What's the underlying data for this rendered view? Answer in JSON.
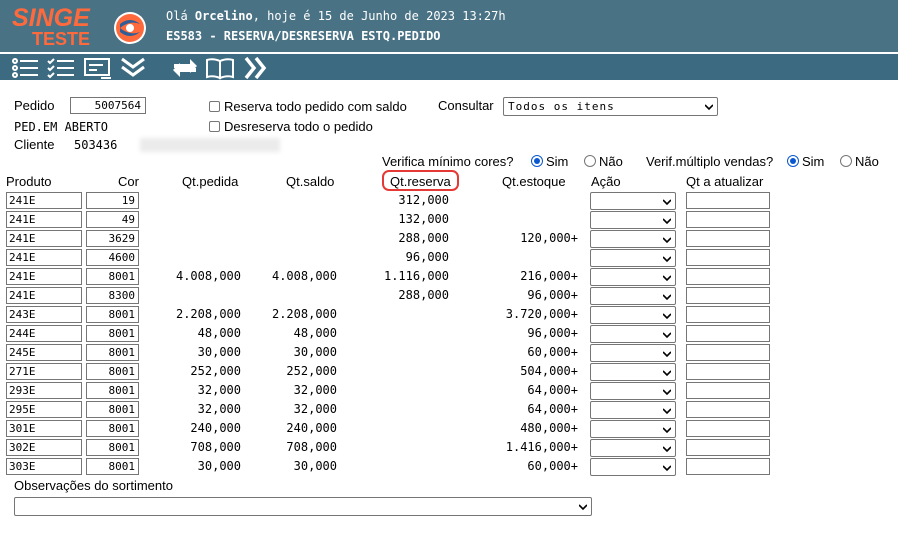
{
  "header": {
    "logo_top": "SINGE",
    "logo_bottom": "TESTE",
    "greeting_prefix": "Olá ",
    "user": "Orcelino",
    "greeting_suffix": ", hoje é 15 de Junho de 2023 13:27h",
    "screen_title": "ES583 - RESERVA/DESRESERVA ESTQ.PEDIDO"
  },
  "colors": {
    "header_bg": "#4a7285",
    "toolbar_bg": "#3c6a80",
    "logo": "#ff6a3d",
    "highlight": "#e53935"
  },
  "toolbar": {
    "icons": [
      "list-icon",
      "checklist-icon",
      "card-icon",
      "double-chevron-down-icon",
      "refresh-icon",
      "book-icon",
      "double-chevron-right-icon"
    ]
  },
  "form": {
    "pedido_label": "Pedido",
    "pedido_value": "5007564",
    "status": "PED.EM ABERTO",
    "cliente_label": "Cliente",
    "cliente_code": "503436",
    "reserva_todo": "Reserva todo pedido com saldo",
    "desreserva_todo": "Desreserva todo o pedido",
    "consultar_label": "Consultar",
    "consultar_value": "Todos os itens",
    "verifica_cores_label": "Verifica mínimo cores?",
    "verif_multiplo_label": "Verif.múltiplo vendas?",
    "sim": "Sim",
    "nao": "Não",
    "observacoes_label": "Observações do sortimento"
  },
  "table": {
    "headers": {
      "produto": "Produto",
      "cor": "Cor",
      "qt_pedida": "Qt.pedida",
      "qt_saldo": "Qt.saldo",
      "qt_reserva": "Qt.reserva",
      "qt_estoque": "Qt.estoque",
      "acao": "Ação",
      "qt_atualizar": "Qt a atualizar"
    },
    "rows": [
      {
        "produto": "241E",
        "cor": "19",
        "qt_pedida": "",
        "qt_saldo": "",
        "qt_reserva": "312,000",
        "qt_estoque": ""
      },
      {
        "produto": "241E",
        "cor": "49",
        "qt_pedida": "",
        "qt_saldo": "",
        "qt_reserva": "132,000",
        "qt_estoque": ""
      },
      {
        "produto": "241E",
        "cor": "3629",
        "qt_pedida": "",
        "qt_saldo": "",
        "qt_reserva": "288,000",
        "qt_estoque": "120,000+"
      },
      {
        "produto": "241E",
        "cor": "4600",
        "qt_pedida": "",
        "qt_saldo": "",
        "qt_reserva": "96,000",
        "qt_estoque": ""
      },
      {
        "produto": "241E",
        "cor": "8001",
        "qt_pedida": "4.008,000",
        "qt_saldo": "4.008,000",
        "qt_reserva": "1.116,000",
        "qt_estoque": "216,000+"
      },
      {
        "produto": "241E",
        "cor": "8300",
        "qt_pedida": "",
        "qt_saldo": "",
        "qt_reserva": "288,000",
        "qt_estoque": "96,000+"
      },
      {
        "produto": "243E",
        "cor": "8001",
        "qt_pedida": "2.208,000",
        "qt_saldo": "2.208,000",
        "qt_reserva": "",
        "qt_estoque": "3.720,000+"
      },
      {
        "produto": "244E",
        "cor": "8001",
        "qt_pedida": "48,000",
        "qt_saldo": "48,000",
        "qt_reserva": "",
        "qt_estoque": "96,000+"
      },
      {
        "produto": "245E",
        "cor": "8001",
        "qt_pedida": "30,000",
        "qt_saldo": "30,000",
        "qt_reserva": "",
        "qt_estoque": "60,000+"
      },
      {
        "produto": "271E",
        "cor": "8001",
        "qt_pedida": "252,000",
        "qt_saldo": "252,000",
        "qt_reserva": "",
        "qt_estoque": "504,000+"
      },
      {
        "produto": "293E",
        "cor": "8001",
        "qt_pedida": "32,000",
        "qt_saldo": "32,000",
        "qt_reserva": "",
        "qt_estoque": "64,000+"
      },
      {
        "produto": "295E",
        "cor": "8001",
        "qt_pedida": "32,000",
        "qt_saldo": "32,000",
        "qt_reserva": "",
        "qt_estoque": "64,000+"
      },
      {
        "produto": "301E",
        "cor": "8001",
        "qt_pedida": "240,000",
        "qt_saldo": "240,000",
        "qt_reserva": "",
        "qt_estoque": "480,000+"
      },
      {
        "produto": "302E",
        "cor": "8001",
        "qt_pedida": "708,000",
        "qt_saldo": "708,000",
        "qt_reserva": "",
        "qt_estoque": "1.416,000+"
      },
      {
        "produto": "303E",
        "cor": "8001",
        "qt_pedida": "30,000",
        "qt_saldo": "30,000",
        "qt_reserva": "",
        "qt_estoque": "60,000+"
      }
    ]
  }
}
